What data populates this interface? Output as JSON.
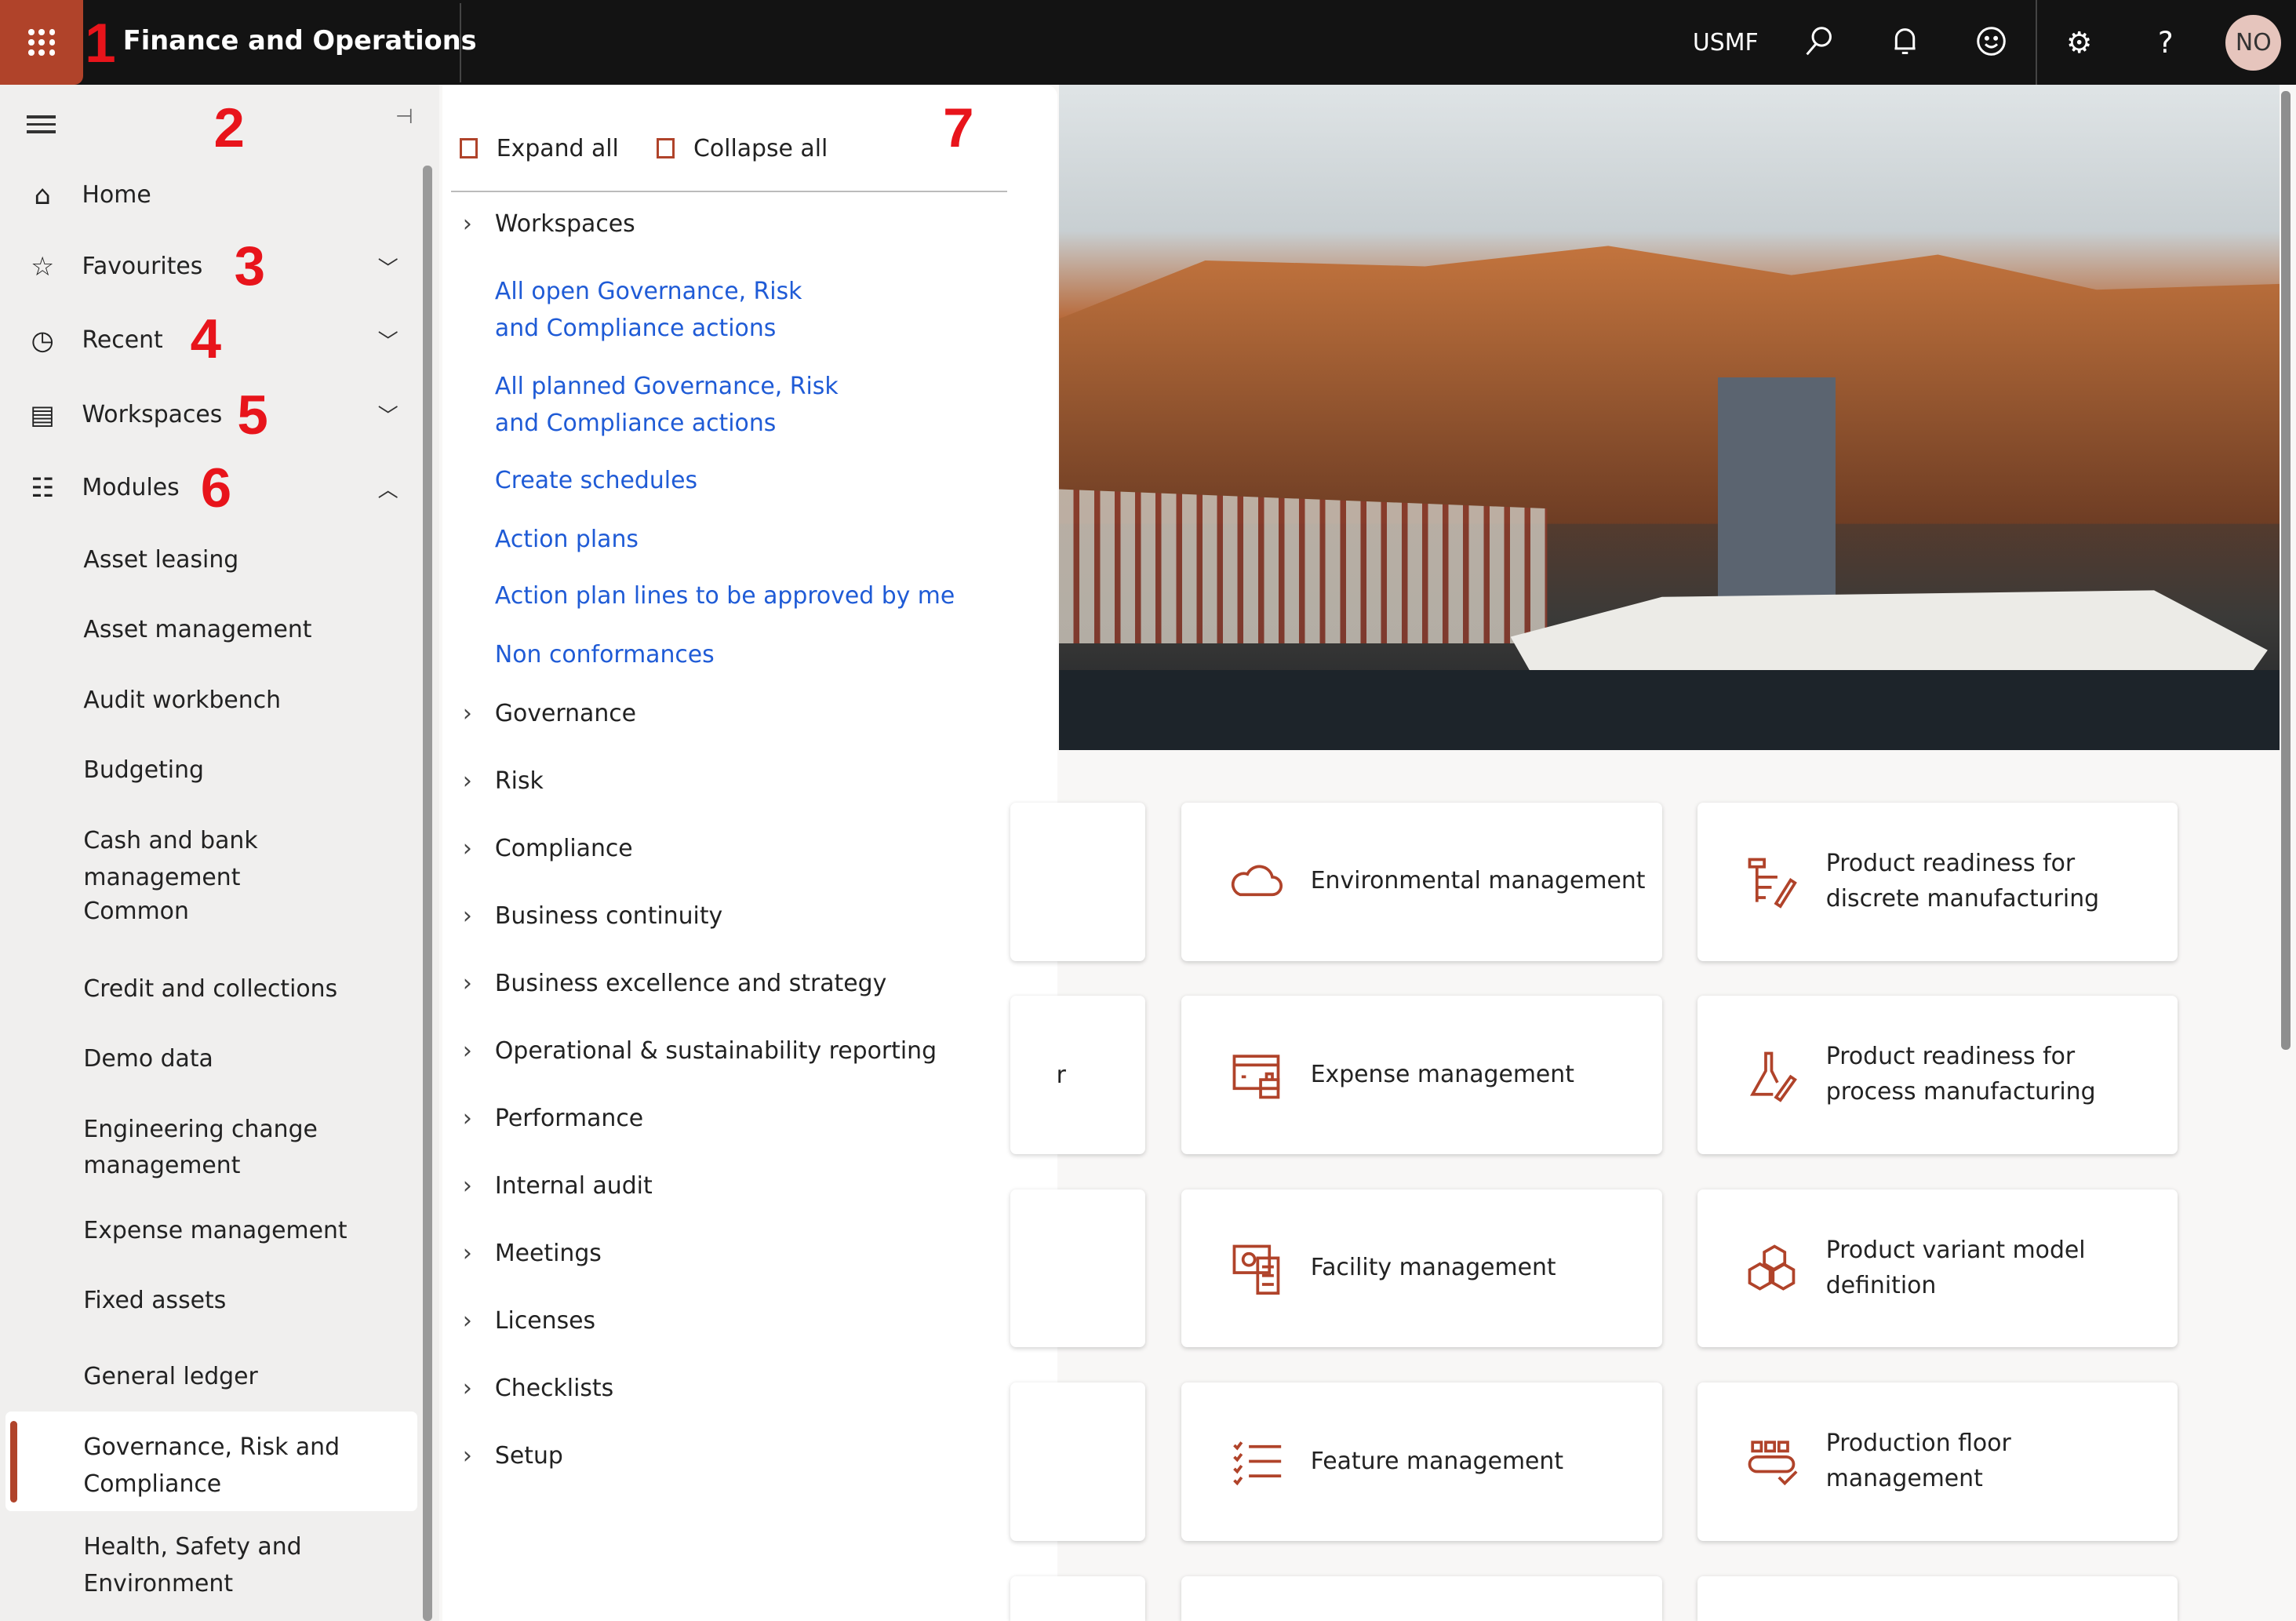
{
  "topbar": {
    "app_title": "Finance and Operations",
    "company": "USMF",
    "avatar_initials": "NO",
    "icons": [
      "waffle-icon",
      "search-icon",
      "bell-icon",
      "smiley-icon",
      "gear-icon",
      "help-icon"
    ]
  },
  "annotations": [
    "1",
    "2",
    "3",
    "4",
    "5",
    "6",
    "7"
  ],
  "nav": {
    "items": [
      {
        "label": "Home",
        "icon": "home-icon"
      },
      {
        "label": "Favourites",
        "icon": "star-icon"
      },
      {
        "label": "Recent",
        "icon": "clock-icon"
      },
      {
        "label": "Workspaces",
        "icon": "workspace-icon"
      },
      {
        "label": "Modules",
        "icon": "list-icon"
      }
    ],
    "modules": [
      "Asset leasing",
      "Asset management",
      "Audit workbench",
      "Budgeting",
      "Cash and bank management",
      "Common",
      "Credit and collections",
      "Demo data",
      "Engineering change management",
      "Expense management",
      "Fixed assets",
      "General ledger",
      "Governance, Risk and Compliance",
      "Health, Safety and Environment"
    ],
    "selected_module": "Governance, Risk and Compliance"
  },
  "flyout": {
    "expand_all": "Expand all",
    "collapse_all": "Collapse all",
    "workspaces": "Workspaces",
    "links": [
      "All open Governance, Risk and Compliance actions",
      "All planned Governance, Risk and Compliance actions",
      "Create schedules",
      "Action plans",
      "Action plan lines to be approved by me",
      "Non conformances"
    ],
    "groups": [
      "Governance",
      "Risk",
      "Compliance",
      "Business continuity",
      "Business excellence and strategy",
      "Operational & sustainability reporting",
      "Performance",
      "Internal audit",
      "Meetings",
      "Licenses",
      "Checklists",
      "Setup"
    ]
  },
  "tiles": [
    {
      "label": "Environmental management",
      "icon": "cloud-icon"
    },
    {
      "label": "Product readiness for discrete manufacturing",
      "icon": "discrete-manufacturing-icon"
    },
    {
      "label": "Expense management",
      "icon": "expense-icon"
    },
    {
      "label": "Product readiness for process manufacturing",
      "icon": "flask-icon"
    },
    {
      "label": "Facility management",
      "icon": "facility-icon"
    },
    {
      "label": "Product variant model definition",
      "icon": "cubes-icon"
    },
    {
      "label": "Feature management",
      "icon": "checklist-icon"
    },
    {
      "label": "Production floor management",
      "icon": "conveyor-icon"
    }
  ],
  "partial_tile_text": "r",
  "colors": {
    "accent": "#b0432a",
    "link": "#1f5bd6",
    "topbar": "#131313",
    "annotation": "#e8141b"
  }
}
